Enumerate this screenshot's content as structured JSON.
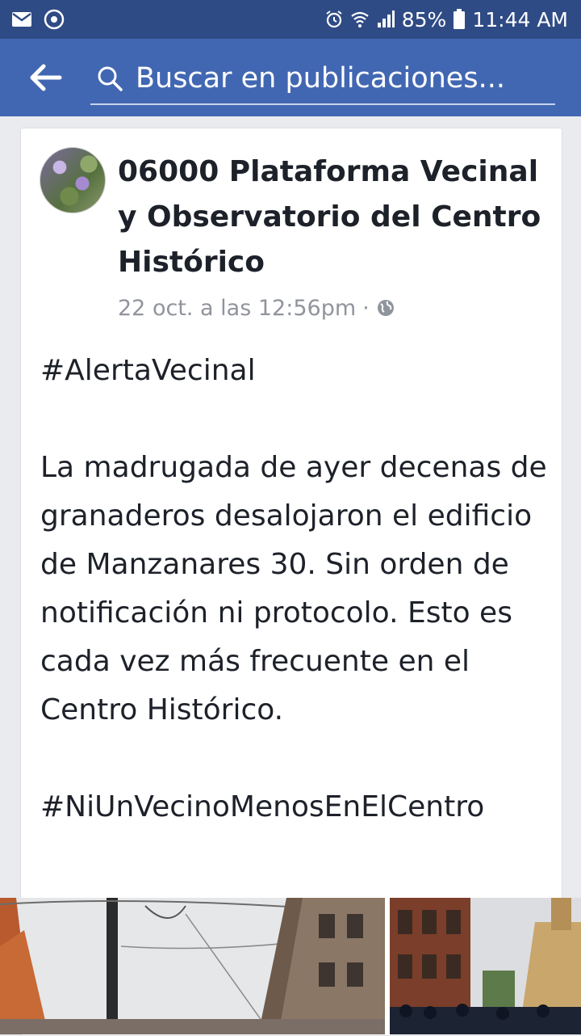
{
  "status_bar": {
    "battery": "85%",
    "time": "11:44 AM",
    "icons": [
      "mail-icon",
      "messenger-icon",
      "alarm-icon",
      "wifi-icon",
      "signal-icon",
      "battery-icon"
    ]
  },
  "app_bar": {
    "back_icon": "arrow-left-icon",
    "search_icon": "search-icon",
    "search_placeholder": "Buscar en publicaciones..."
  },
  "post": {
    "page_name": "06000 Plataforma Vecinal y Observatorio del Centro Histórico",
    "timestamp": "22 oct. a las 12:56pm",
    "separator": "·",
    "privacy_icon": "globe-icon",
    "hashtag_1": "#AlertaVecinal",
    "body": "La madrugada de ayer decenas de granaderos desalojaron el edificio de Manzanares 30. Sin orden de notificación ni protocolo. Esto es cada vez más frecuente en el Centro Histórico.",
    "hashtag_2": "#NiUnVecinoMenosEnElCentro"
  },
  "colors": {
    "status_bar": "#2f4b85",
    "app_bar": "#4267b2",
    "background": "#e9ebee",
    "meta_text": "#90949c"
  }
}
